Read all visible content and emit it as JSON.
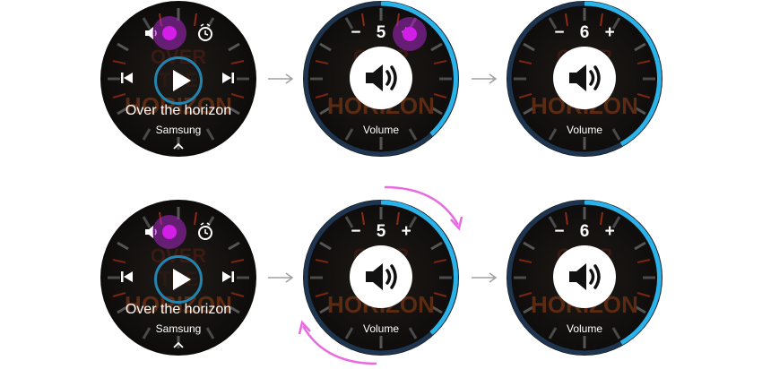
{
  "player": {
    "song_title": "Over the horizon",
    "artist": "Samsung",
    "bg_words": [
      "OVER",
      "THE",
      "HORIZON"
    ]
  },
  "volume_screens": [
    {
      "value": "5",
      "label": "Volume",
      "minus": "−",
      "plus": "+"
    },
    {
      "value": "6",
      "label": "Volume",
      "minus": "−",
      "plus": "+"
    },
    {
      "value": "5",
      "label": "Volume",
      "minus": "−",
      "plus": "+"
    },
    {
      "value": "6",
      "label": "Volume",
      "minus": "−",
      "plus": "+"
    }
  ],
  "colors": {
    "watch_bg": "#141414",
    "accent_blue": "#2bb2e8",
    "touch_purple": "#d21ee6",
    "rotation_arrow": "#e86ce0",
    "flow_arrow": "#a0a0a0"
  },
  "icons": [
    "volume-icon",
    "alarm-clock-icon",
    "previous-track-icon",
    "play-icon",
    "next-track-icon",
    "chevron-up-icon",
    "speaker-icon",
    "right-arrow-icon",
    "rotate-clockwise-icon"
  ]
}
